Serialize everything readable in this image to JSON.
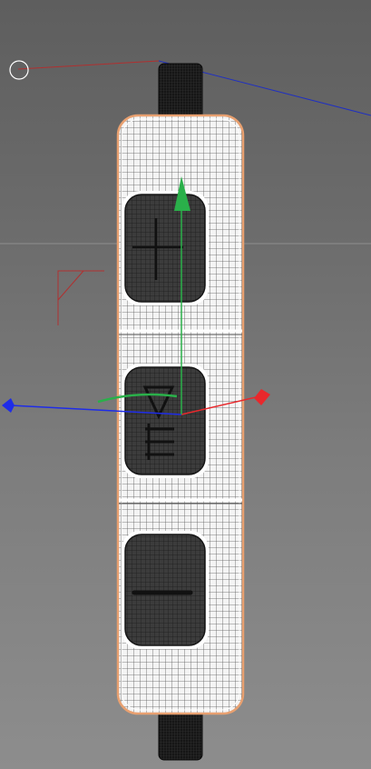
{
  "viewport": {
    "label": "",
    "background": "#6f6f6f",
    "mesh_color": "#ffffff",
    "selection_outline_color": "#e8a070",
    "cable_color": "#1c1c1c",
    "button_color": "#3a3a3a"
  },
  "gizmo": {
    "x_axis_color": "#e8282c",
    "y_axis_color": "#2ab04a",
    "z_axis_color": "#1e2ce8",
    "rotation_handle_color": "#2ab04a"
  },
  "remote_buttons": [
    {
      "name": "volume-up-button",
      "icon": "plus-icon"
    },
    {
      "name": "play-pause-button",
      "icon": "play-pause-icon"
    },
    {
      "name": "volume-down-button",
      "icon": "minus-icon"
    }
  ]
}
